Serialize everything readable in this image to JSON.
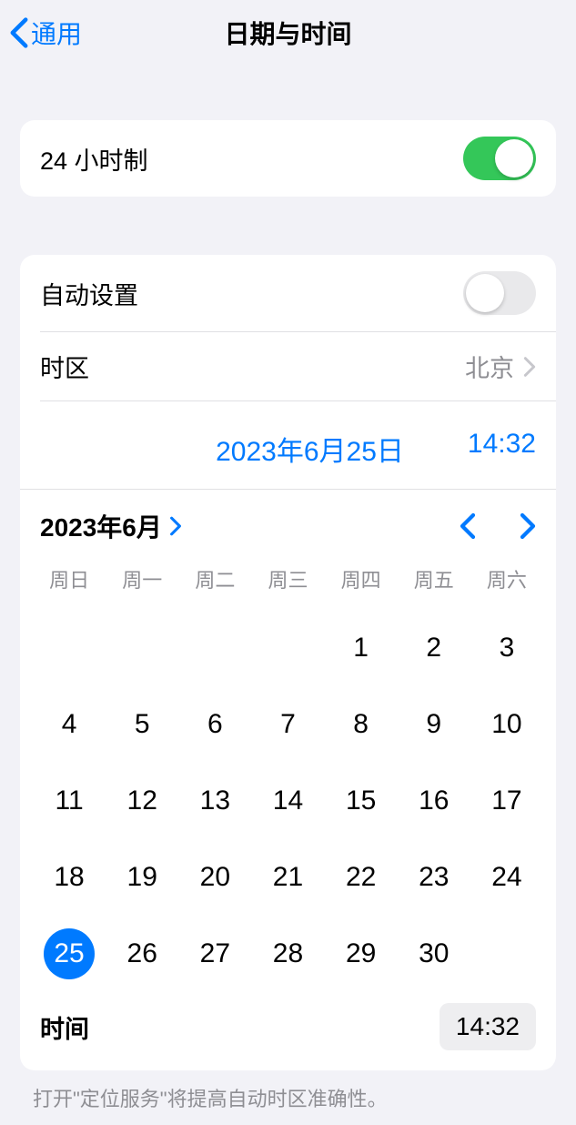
{
  "nav": {
    "back_label": "通用",
    "title": "日期与时间"
  },
  "section1": {
    "clock24_label": "24 小时制",
    "clock24_on": true
  },
  "section2": {
    "auto_set_label": "自动设置",
    "auto_set_on": false,
    "timezone_label": "时区",
    "timezone_value": "北京",
    "selected_date": "2023年6月25日",
    "selected_time": "14:32"
  },
  "calendar": {
    "month_year": "2023年6月",
    "weekdays": [
      "周日",
      "周一",
      "周二",
      "周三",
      "周四",
      "周五",
      "周六"
    ],
    "leading_blanks": 4,
    "days": [
      1,
      2,
      3,
      4,
      5,
      6,
      7,
      8,
      9,
      10,
      11,
      12,
      13,
      14,
      15,
      16,
      17,
      18,
      19,
      20,
      21,
      22,
      23,
      24,
      25,
      26,
      27,
      28,
      29,
      30
    ],
    "selected_day": 25
  },
  "time_row": {
    "label": "时间",
    "value": "14:32"
  },
  "footer": {
    "note": "打开\"定位服务\"将提高自动时区准确性。"
  }
}
